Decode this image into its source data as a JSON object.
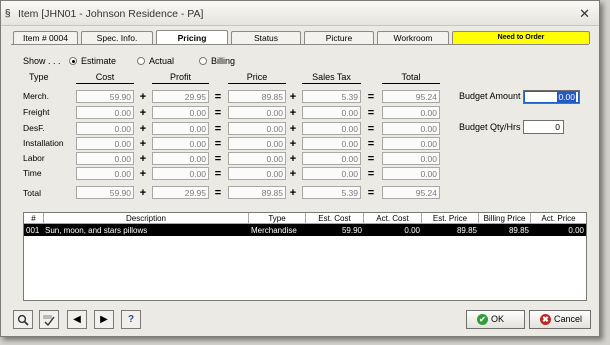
{
  "window": {
    "title": "Item [JHN01 - Johnson Residence - PA]",
    "icon": "§"
  },
  "tabs": [
    {
      "label": "Item # 0004"
    },
    {
      "label": "Spec. Info."
    },
    {
      "label": "Pricing"
    },
    {
      "label": "Status"
    },
    {
      "label": "Picture"
    },
    {
      "label": "Workroom"
    },
    {
      "label": "Need to Order"
    }
  ],
  "show": {
    "label": "Show . . .",
    "options": [
      {
        "label": "Estimate",
        "selected": true
      },
      {
        "label": "Actual",
        "selected": false
      },
      {
        "label": "Billing",
        "selected": false
      }
    ]
  },
  "columns": {
    "type": "Type",
    "cost": "Cost",
    "profit": "Profit",
    "price": "Price",
    "tax": "Sales Tax",
    "total": "Total"
  },
  "ops": {
    "plus": "+",
    "equals": "="
  },
  "rows": [
    {
      "label": "Merch.",
      "cost": "59.90",
      "profit": "29.95",
      "price": "89.85",
      "tax": "5.39",
      "total": "95.24"
    },
    {
      "label": "Freight",
      "cost": "0.00",
      "profit": "0.00",
      "price": "0.00",
      "tax": "0.00",
      "total": "0.00"
    },
    {
      "label": "DesF.",
      "cost": "0.00",
      "profit": "0.00",
      "price": "0.00",
      "tax": "0.00",
      "total": "0.00"
    },
    {
      "label": "Installation",
      "cost": "0.00",
      "profit": "0.00",
      "price": "0.00",
      "tax": "0.00",
      "total": "0.00"
    },
    {
      "label": "Labor",
      "cost": "0.00",
      "profit": "0.00",
      "price": "0.00",
      "tax": "0.00",
      "total": "0.00"
    },
    {
      "label": "Time",
      "cost": "0.00",
      "profit": "0.00",
      "price": "0.00",
      "tax": "0.00",
      "total": "0.00"
    }
  ],
  "totals": {
    "label": "Total",
    "cost": "59.90",
    "profit": "29.95",
    "price": "89.85",
    "tax": "5.39",
    "total": "95.24"
  },
  "budget": {
    "amount_label": "Budget Amount",
    "amount_value": "0.00",
    "qty_label": "Budget Qty/Hrs",
    "qty_value": "0"
  },
  "grid": {
    "headers": [
      "#",
      "Description",
      "Type",
      "Est. Cost",
      "Act. Cost",
      "Est. Price",
      "Billing Price",
      "Act. Price"
    ],
    "rows": [
      [
        "001",
        "Sun, moon, and stars pillows",
        "Merchandise",
        "59.90",
        "0.00",
        "89.85",
        "89.85",
        "0.00"
      ]
    ]
  },
  "bottom": {
    "ok_label": "OK",
    "cancel_label": "Cancel",
    "prev_glyph": "◀",
    "next_glyph": "▶",
    "help_glyph": "?",
    "ok_glyph": "✔",
    "cancel_glyph": "✖"
  },
  "colors": {
    "tab_warning": "#ffff00",
    "selected_row": "#000000",
    "focus": "#2457c8"
  }
}
